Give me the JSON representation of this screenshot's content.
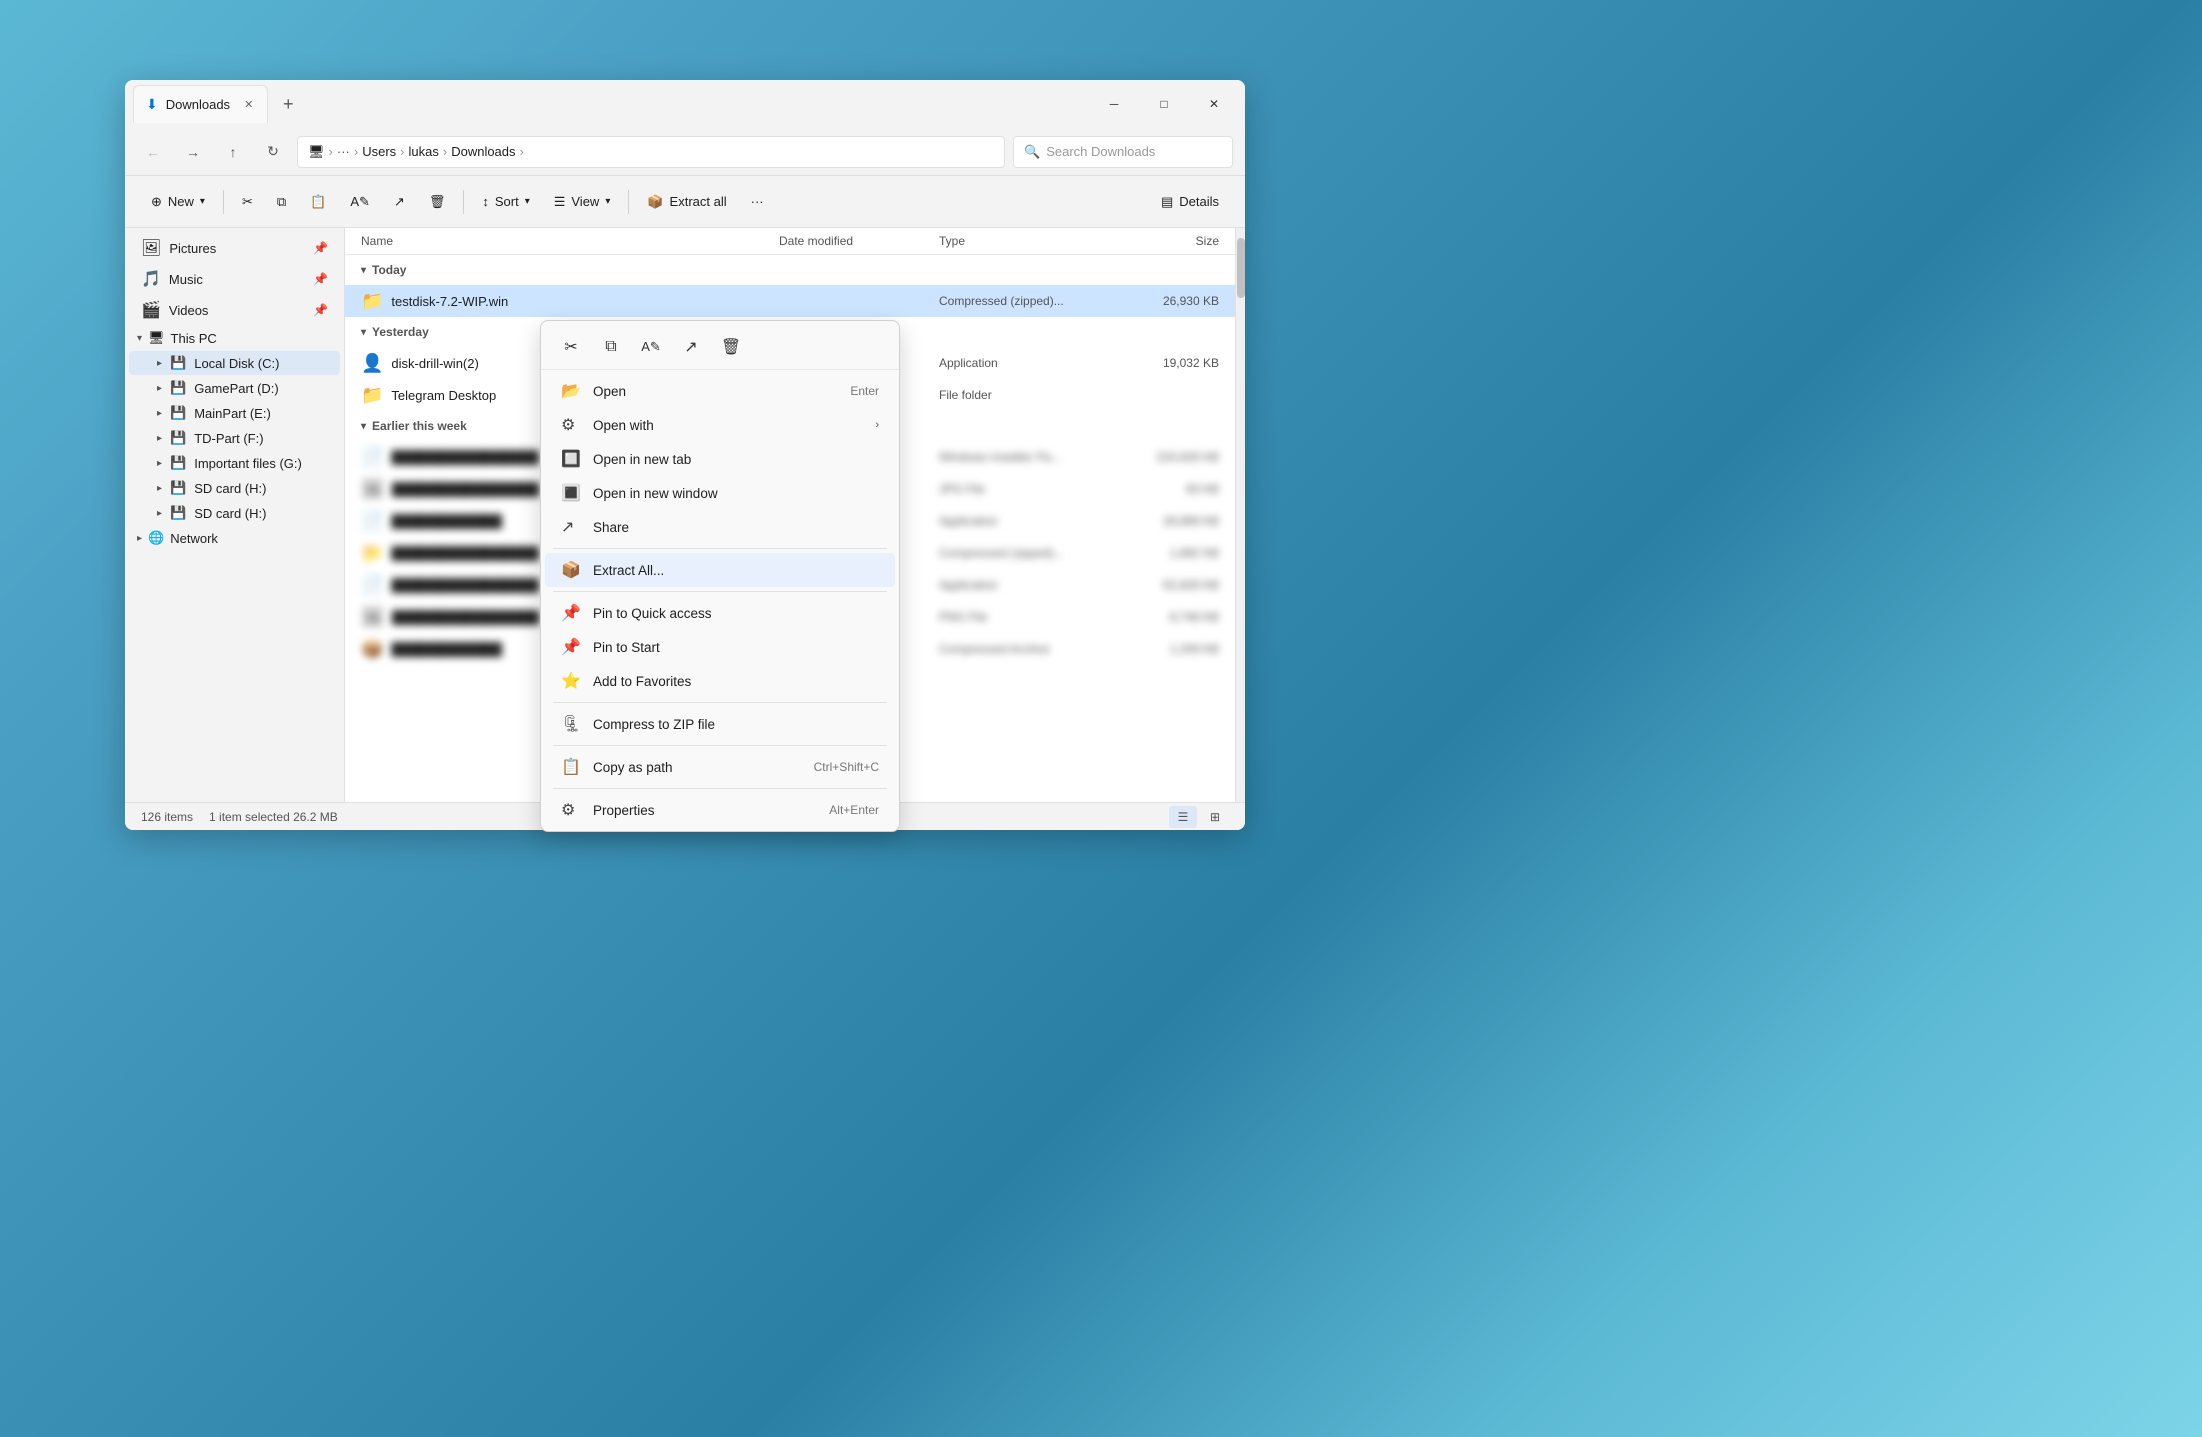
{
  "window": {
    "title": "Downloads",
    "tab_label": "Downloads",
    "tab_icon": "⬇",
    "new_tab_icon": "+",
    "minimize_icon": "─",
    "maximize_icon": "□",
    "close_icon": "✕"
  },
  "nav": {
    "back_icon": "←",
    "forward_icon": "→",
    "up_icon": "↑",
    "refresh_icon": "↻",
    "breadcrumb": {
      "pc_icon": "🖥",
      "items": [
        "Users",
        "lukas",
        "Downloads"
      ],
      "separator": "›"
    },
    "search_placeholder": "Search Downloads"
  },
  "toolbar": {
    "new_label": "New",
    "new_icon": "⊕",
    "cut_icon": "✂",
    "copy_icon": "⧉",
    "paste_icon": "📋",
    "rename_icon": "A✎",
    "share_icon": "↗",
    "delete_icon": "🗑",
    "sort_label": "Sort",
    "sort_icon": "↕",
    "view_label": "View",
    "view_icon": "☰",
    "extract_all_label": "Extract all",
    "extract_icon": "📦",
    "more_icon": "···",
    "details_label": "Details",
    "details_icon": "▤"
  },
  "sidebar": {
    "items_pinned": [
      {
        "label": "Pictures",
        "icon": "🖼"
      },
      {
        "label": "Music",
        "icon": "🎵"
      },
      {
        "label": "Videos",
        "icon": "🎬"
      }
    ],
    "this_pc_label": "This PC",
    "this_pc_icon": "🖥",
    "drives": [
      {
        "label": "Local Disk (C:)",
        "icon": "💾",
        "selected": true
      },
      {
        "label": "GamePart (D:)",
        "icon": "💾"
      },
      {
        "label": "MainPart (E:)",
        "icon": "💾"
      },
      {
        "label": "TD-Part (F:)",
        "icon": "💾"
      },
      {
        "label": "Important files (G:)",
        "icon": "💾"
      },
      {
        "label": "SD card (H:)",
        "icon": "💾"
      },
      {
        "label": "SD card (H:)",
        "icon": "💾"
      }
    ],
    "network_label": "Network",
    "network_icon": "🌐"
  },
  "file_list": {
    "columns": {
      "name": "Name",
      "date_modified": "Date modified",
      "type": "Type",
      "size": "Size"
    },
    "groups": [
      {
        "label": "Today",
        "files": [
          {
            "name": "testdisk-7.2-WIP.win",
            "icon": "📁",
            "type": "Compressed (zipped)...",
            "size": "26,930 KB",
            "selected": true
          }
        ]
      },
      {
        "label": "Yesterday",
        "files": [
          {
            "name": "disk-drill-win(2)",
            "icon": "👤",
            "type": "Application",
            "size": "19,032 KB",
            "blurred": false
          },
          {
            "name": "Telegram Desktop",
            "icon": "📁",
            "type": "File folder",
            "size": "",
            "blurred": false
          }
        ]
      },
      {
        "label": "Earlier this week",
        "files": [
          {
            "name": "████████████████",
            "icon": "📄",
            "type": "Windows Installer Pa...",
            "size": "224,626 KB",
            "blurred": true
          },
          {
            "name": "████████████████",
            "icon": "🖼",
            "type": "JPG File",
            "size": "83 KB",
            "blurred": true
          },
          {
            "name": "████████████",
            "icon": "📄",
            "type": "Application",
            "size": "28,899 KB",
            "blurred": true
          },
          {
            "name": "████████████████",
            "icon": "📁",
            "type": "Compressed (zipped)...",
            "size": "1,892 KB",
            "blurred": true
          },
          {
            "name": "████████████████",
            "icon": "📄",
            "type": "Application",
            "size": "62,828 KB",
            "blurred": true
          },
          {
            "name": "████████████████",
            "icon": "🖼",
            "type": "PNG File",
            "size": "8,748 KB",
            "blurred": true
          },
          {
            "name": "████████████",
            "icon": "📦",
            "type": "Compressed Archive",
            "size": "1,209 KB",
            "blurred": true
          }
        ]
      }
    ]
  },
  "status_bar": {
    "item_count": "126 items",
    "selected_info": "1 item selected  26.2 MB",
    "list_view_icon": "☰",
    "grid_view_icon": "⊞"
  },
  "context_menu": {
    "toolbar_items": [
      {
        "icon": "✂",
        "label": "Cut"
      },
      {
        "icon": "⧉",
        "label": "Copy"
      },
      {
        "icon": "A✎",
        "label": "Rename"
      },
      {
        "icon": "↗",
        "label": "Share"
      },
      {
        "icon": "🗑",
        "label": "Delete"
      }
    ],
    "items": [
      {
        "icon": "📂",
        "label": "Open",
        "shortcut": "Enter",
        "separator_after": false
      },
      {
        "icon": "⚙",
        "label": "Open with",
        "arrow": "›",
        "separator_after": false
      },
      {
        "icon": "🔲",
        "label": "Open in new tab",
        "separator_after": false
      },
      {
        "icon": "🔳",
        "label": "Open in new window",
        "separator_after": false
      },
      {
        "icon": "↗",
        "label": "Share",
        "separator_after": true
      },
      {
        "icon": "📦",
        "label": "Extract All...",
        "highlighted": true,
        "separator_after": true
      },
      {
        "icon": "📌",
        "label": "Pin to Quick access",
        "separator_after": false
      },
      {
        "icon": "📌",
        "label": "Pin to Start",
        "separator_after": false
      },
      {
        "icon": "⭐",
        "label": "Add to Favorites",
        "separator_after": true
      },
      {
        "icon": "🗜",
        "label": "Compress to ZIP file",
        "separator_after": true
      },
      {
        "icon": "📋",
        "label": "Copy as path",
        "shortcut": "Ctrl+Shift+C",
        "separator_after": true
      },
      {
        "icon": "⚙",
        "label": "Properties",
        "shortcut": "Alt+Enter",
        "separator_after": false
      }
    ]
  }
}
